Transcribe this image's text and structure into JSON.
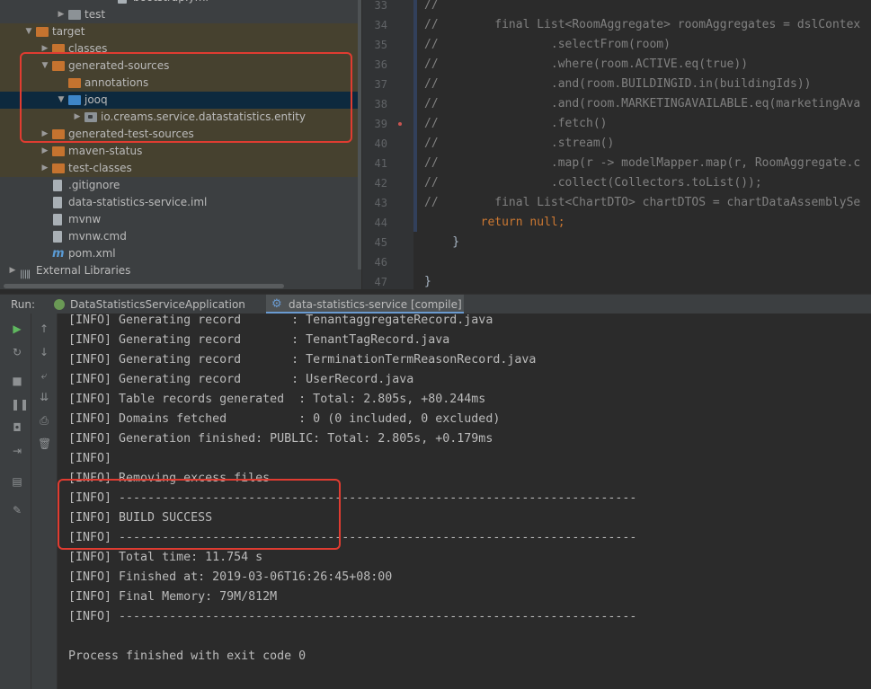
{
  "tree": {
    "items": [
      {
        "label": "bootstrap.yml",
        "depth": 6,
        "icon": "file-icon",
        "expand": ""
      },
      {
        "label": "test",
        "depth": 3,
        "icon": "folder-gray",
        "expand": "collapsed"
      },
      {
        "label": "target",
        "depth": 1,
        "icon": "folder-orange",
        "expand": "expanded",
        "excluded": true
      },
      {
        "label": "classes",
        "depth": 2,
        "icon": "folder-orange",
        "expand": "collapsed",
        "excluded": true
      },
      {
        "label": "generated-sources",
        "depth": 2,
        "icon": "folder-orange",
        "expand": "expanded",
        "excluded": true
      },
      {
        "label": "annotations",
        "depth": 3,
        "icon": "folder-orange",
        "expand": "",
        "excluded": true
      },
      {
        "label": "jooq",
        "depth": 3,
        "icon": "folder-blue",
        "expand": "expanded",
        "selected": true
      },
      {
        "label": "io.creams.service.datastatistics.entity",
        "depth": 4,
        "icon": "package",
        "expand": "collapsed",
        "excluded": true
      },
      {
        "label": "generated-test-sources",
        "depth": 2,
        "icon": "folder-orange",
        "expand": "collapsed",
        "excluded": true
      },
      {
        "label": "maven-status",
        "depth": 2,
        "icon": "folder-orange",
        "expand": "collapsed",
        "excluded": true
      },
      {
        "label": "test-classes",
        "depth": 2,
        "icon": "folder-orange",
        "expand": "collapsed",
        "excluded": true
      },
      {
        "label": ".gitignore",
        "depth": 2,
        "icon": "file-icon",
        "expand": ""
      },
      {
        "label": "data-statistics-service.iml",
        "depth": 2,
        "icon": "file-icon",
        "expand": ""
      },
      {
        "label": "mvnw",
        "depth": 2,
        "icon": "file-icon",
        "expand": ""
      },
      {
        "label": "mvnw.cmd",
        "depth": 2,
        "icon": "file-icon",
        "expand": ""
      },
      {
        "label": "pom.xml",
        "depth": 2,
        "icon": "maven-icon",
        "expand": ""
      },
      {
        "label": "External Libraries",
        "depth": 0,
        "icon": "library-icon",
        "expand": "collapsed"
      }
    ]
  },
  "editor": {
    "lines": [
      {
        "num": "33",
        "text": "//",
        "live": false
      },
      {
        "num": "34",
        "text": "//        final List<RoomAggregate> roomAggregates = dslContex",
        "live": false
      },
      {
        "num": "35",
        "text": "//                .selectFrom(room)",
        "live": false
      },
      {
        "num": "36",
        "text": "//                .where(room.ACTIVE.eq(true))",
        "live": false
      },
      {
        "num": "37",
        "text": "//                .and(room.BUILDINGID.in(buildingIds))",
        "live": false
      },
      {
        "num": "38",
        "text": "//                .and(room.MARKETINGAVAILABLE.eq(marketingAva",
        "live": false
      },
      {
        "num": "39",
        "text": "//                .fetch()",
        "live": false
      },
      {
        "num": "40",
        "text": "//                .stream()",
        "live": false
      },
      {
        "num": "41",
        "text": "//                .map(r -> modelMapper.map(r, RoomAggregate.c",
        "live": false
      },
      {
        "num": "42",
        "text": "//                .collect(Collectors.toList());",
        "live": false
      },
      {
        "num": "43",
        "text": "//        final List<ChartDTO> chartDTOS = chartDataAssemblySe",
        "live": false
      },
      {
        "num": "44",
        "text": "        return null;",
        "live": true,
        "kw": true
      },
      {
        "num": "45",
        "text": "    }",
        "live": true
      },
      {
        "num": "46",
        "text": "",
        "live": true
      },
      {
        "num": "47",
        "text": "}",
        "live": true
      }
    ]
  },
  "run": {
    "label": "Run:",
    "tabs": [
      {
        "label": "DataStatisticsServiceApplication",
        "icon": "spring-boot-icon",
        "active": false
      },
      {
        "label": "data-statistics-service [compile]",
        "icon": "gear-icon",
        "active": true
      }
    ]
  },
  "console": {
    "lines": [
      "[INFO] Generating record       : TenantaggregateRecord.java",
      "[INFO] Generating record       : TenantTagRecord.java",
      "[INFO] Generating record       : TerminationTermReasonRecord.java",
      "[INFO] Generating record       : UserRecord.java",
      "[INFO] Table records generated  : Total: 2.805s, +80.244ms",
      "[INFO] Domains fetched          : 0 (0 included, 0 excluded)",
      "[INFO] Generation finished: PUBLIC: Total: 2.805s, +0.179ms",
      "[INFO]",
      "[INFO] Removing excess files",
      "[INFO] ------------------------------------------------------------------------",
      "[INFO] BUILD SUCCESS",
      "[INFO] ------------------------------------------------------------------------",
      "[INFO] Total time: 11.754 s",
      "[INFO] Finished at: 2019-03-06T16:26:45+08:00",
      "[INFO] Final Memory: 79M/812M",
      "[INFO] ------------------------------------------------------------------------",
      "",
      "Process finished with exit code 0"
    ]
  },
  "colors": {
    "accent_red": "#e03c31",
    "excluded_bg": "#46412f",
    "selected_bg": "#0d293e",
    "keyword": "#cc7832",
    "comment": "#808080"
  }
}
